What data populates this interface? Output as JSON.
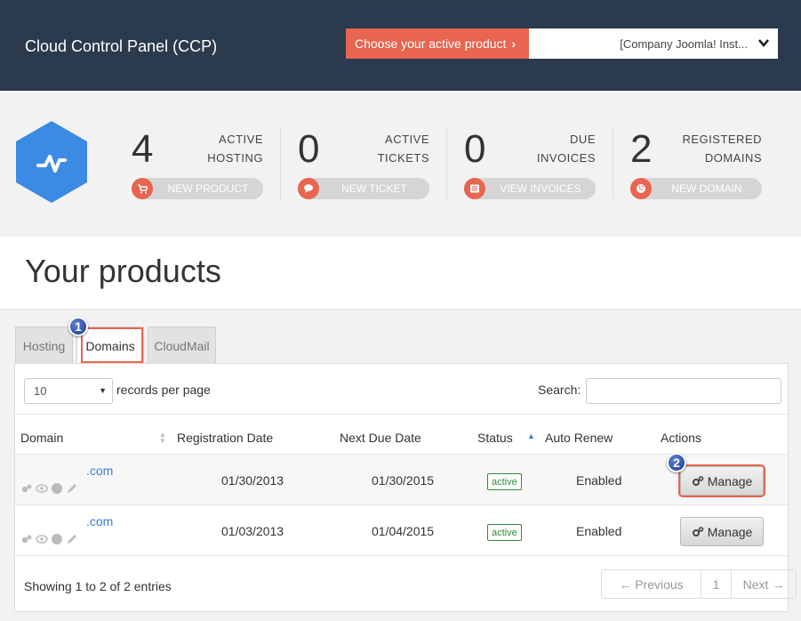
{
  "header": {
    "title": "Cloud Control Panel (CCP)",
    "product_button": "Choose your active product",
    "product_value": "[Company Joomla! Inst..."
  },
  "stats": [
    {
      "count": "4",
      "label_top": "ACTIVE",
      "label_bottom": "HOSTING",
      "button": "NEW PRODUCT",
      "icon": "cart-icon"
    },
    {
      "count": "0",
      "label_top": "ACTIVE",
      "label_bottom": "TICKETS",
      "button": "NEW TICKET",
      "icon": "chat-icon"
    },
    {
      "count": "0",
      "label_top": "DUE",
      "label_bottom": "INVOICES",
      "button": "VIEW INVOICES",
      "icon": "list-icon"
    },
    {
      "count": "2",
      "label_top": "REGISTERED",
      "label_bottom": "DOMAINS",
      "button": "NEW DOMAIN",
      "icon": "globe-icon"
    }
  ],
  "page_title": "Your products",
  "tabs": [
    "Hosting",
    "Domains",
    "CloudMail"
  ],
  "markers": [
    "1",
    "2"
  ],
  "table": {
    "length_value": "10",
    "length_text": "records per page",
    "search_label": "Search:",
    "search_value": "",
    "columns": [
      "Domain",
      "Registration Date",
      "Next Due Date",
      "Status",
      "Auto Renew",
      "Actions"
    ],
    "rows": [
      {
        "domain": ".com",
        "registration": "01/30/2013",
        "next_due": "01/30/2015",
        "status": "active",
        "auto_renew": "Enabled",
        "action": "Manage"
      },
      {
        "domain": ".com",
        "registration": "01/03/2013",
        "next_due": "01/04/2015",
        "status": "active",
        "auto_renew": "Enabled",
        "action": "Manage"
      }
    ],
    "info": "Showing 1 to 2 of 2 entries",
    "pager": {
      "previous": "← Previous",
      "page": "1",
      "next": "Next →"
    }
  },
  "colors": {
    "header_bg": "#2b3a4d",
    "accent": "#e8654f",
    "link": "#3a7fd5",
    "status_green": "#2f8a3b",
    "logo_blue": "#3b8be4"
  }
}
